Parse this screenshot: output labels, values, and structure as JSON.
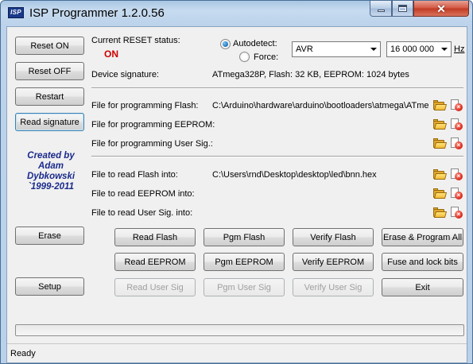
{
  "window": {
    "icon_text": "ISP",
    "title": "ISP Programmer 1.2.0.56"
  },
  "left_buttons": {
    "reset_on": "Reset ON",
    "reset_off": "Reset OFF",
    "restart": "Restart",
    "read_signature": "Read signature",
    "erase": "Erase",
    "setup": "Setup"
  },
  "credit": {
    "line1": "Created by",
    "line2": "Adam",
    "line3": "Dybkowski",
    "line4": "`1999-2011"
  },
  "reset_status": {
    "label": "Current RESET status:",
    "value": "ON"
  },
  "detection": {
    "autodetect_label": "Autodetect:",
    "force_label": "Force:",
    "autodetect_checked": true,
    "chip_family": "AVR",
    "frequency": "16 000 000",
    "frequency_unit": "Hz"
  },
  "device": {
    "label": "Device signature:",
    "value": "ATmega328P, Flash: 32 KB, EEPROM: 1024 bytes"
  },
  "program_files": {
    "flash_label": "File for programming Flash:",
    "flash_value": "C:\\Arduino\\hardware\\arduino\\bootloaders\\atmega\\ATme",
    "eeprom_label": "File for programming EEPROM:",
    "eeprom_value": "",
    "usersig_label": "File for programming User Sig.:",
    "usersig_value": ""
  },
  "read_files": {
    "flash_label": "File to read Flash into:",
    "flash_value": "C:\\Users\\rnd\\Desktop\\desktop\\led\\bnn.hex",
    "eeprom_label": "File to read EEPROM into:",
    "eeprom_value": "",
    "usersig_label": "File to read User Sig. into:",
    "usersig_value": ""
  },
  "actions": {
    "read_flash": "Read Flash",
    "pgm_flash": "Pgm Flash",
    "verify_flash": "Verify Flash",
    "erase_program_all": "Erase & Program All",
    "read_eeprom": "Read EEPROM",
    "pgm_eeprom": "Pgm EEPROM",
    "verify_eeprom": "Verify EEPROM",
    "fuse_lock_bits": "Fuse and lock bits",
    "read_user_sig": "Read User Sig",
    "pgm_user_sig": "Pgm User Sig",
    "verify_user_sig": "Verify User Sig",
    "exit": "Exit"
  },
  "progress": {
    "fraction": 0
  },
  "status_bar": {
    "text": "Ready"
  },
  "colors": {
    "status_on": "#d00000",
    "credit": "#1a2a8c"
  }
}
